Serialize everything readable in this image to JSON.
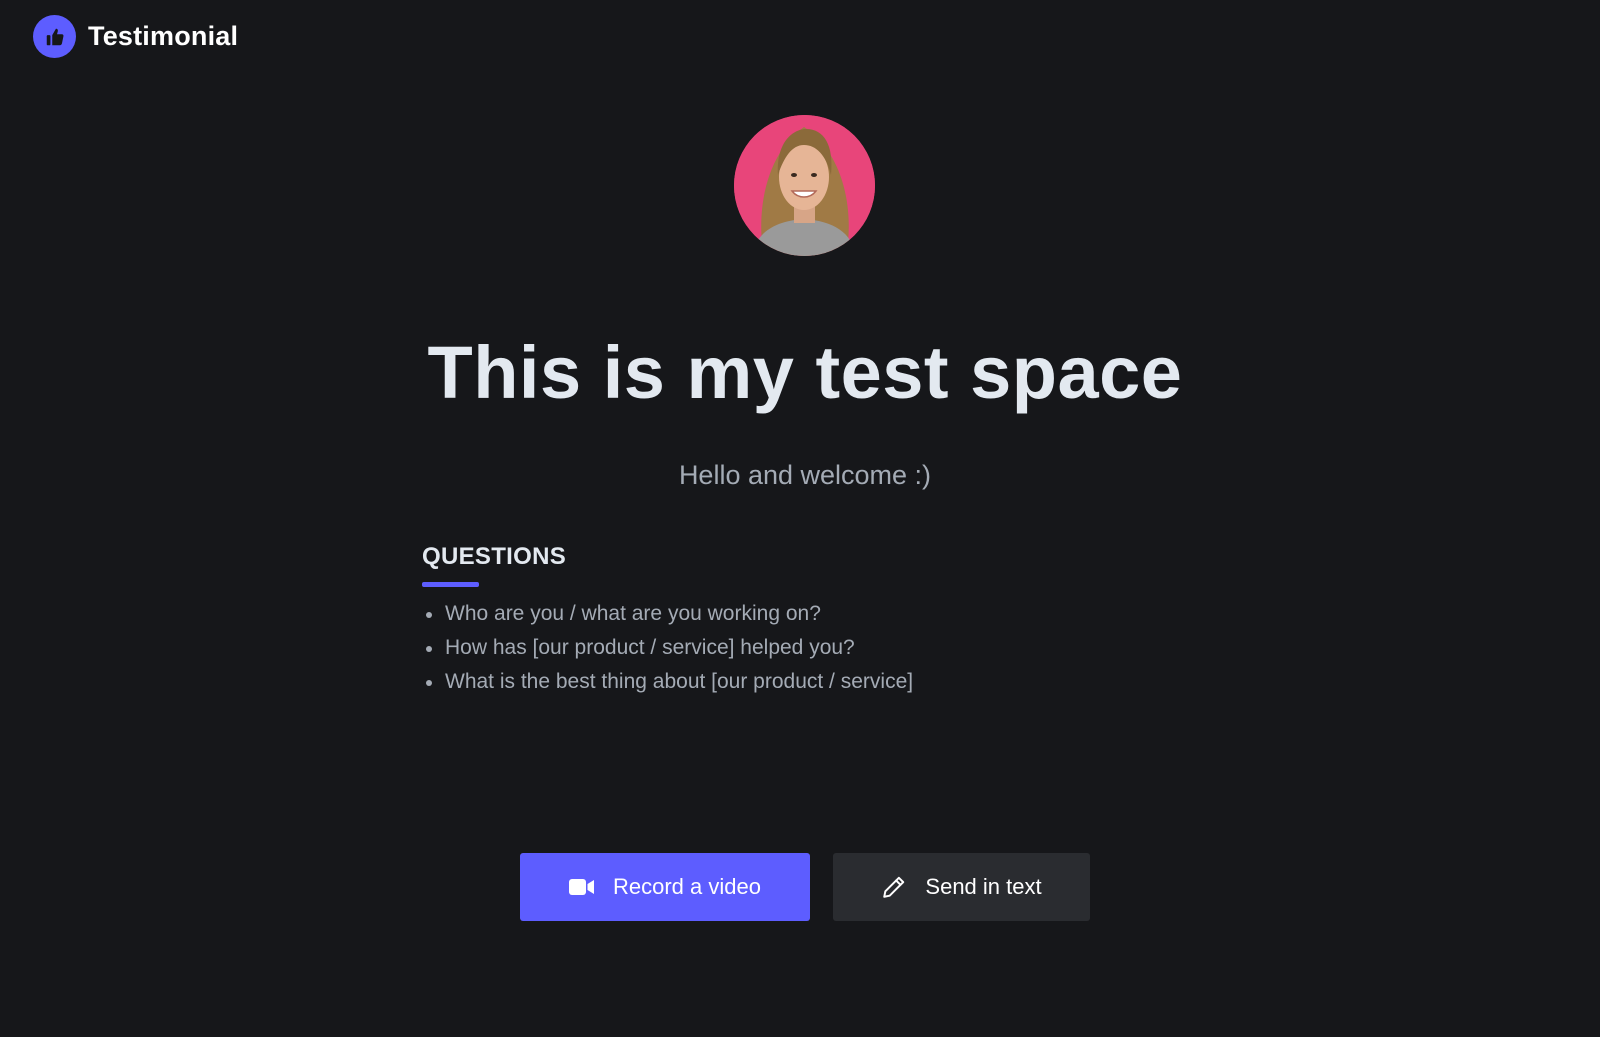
{
  "header": {
    "brand_name": "Testimonial",
    "brand_icon": "thumbs-up-icon"
  },
  "main": {
    "title": "This is my test space",
    "subtitle": "Hello and welcome :)",
    "questions": {
      "heading": "QUESTIONS",
      "items": [
        "Who are you / what are you working on?",
        "How has [our product / service] helped you?",
        "What is the best thing about [our product / service]"
      ]
    }
  },
  "actions": {
    "record_video_label": "Record a video",
    "record_video_icon": "video-camera-icon",
    "send_text_label": "Send in text",
    "send_text_icon": "pencil-icon"
  },
  "colors": {
    "background": "#16171a",
    "accent": "#5d5dff",
    "secondary_button": "#2a2c30",
    "avatar_background": "#e8457a"
  }
}
